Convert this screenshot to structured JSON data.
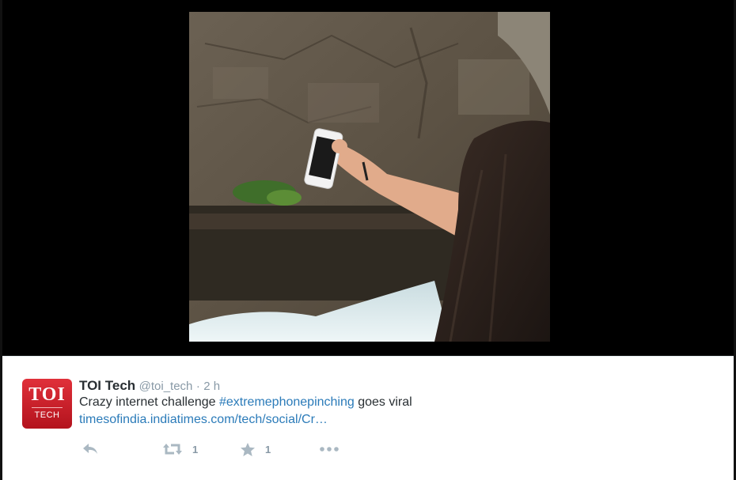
{
  "media": {
    "description_icon": "photo-of-phone-held-over-waterfall"
  },
  "tweet": {
    "avatar_text_top": "TOI",
    "avatar_text_bottom": "TECH",
    "display_name": "TOI Tech",
    "handle": "@toi_tech",
    "separator": "·",
    "time": "2 h",
    "text_before": "Crazy internet challenge ",
    "hashtag": "#extremephonepinching",
    "text_after": " goes viral",
    "link": "timesofindia.indiatimes.com/tech/social/Cr…"
  },
  "actions": {
    "reply_icon": "reply-icon",
    "retweet_icon": "retweet-icon",
    "retweet_count": "1",
    "favorite_icon": "star-icon",
    "favorite_count": "1",
    "more_icon": "more-icon"
  },
  "colors": {
    "link": "#2b7bb9",
    "brand_red": "#d2232a",
    "muted": "#8899a6",
    "icon": "#aab8c2"
  }
}
